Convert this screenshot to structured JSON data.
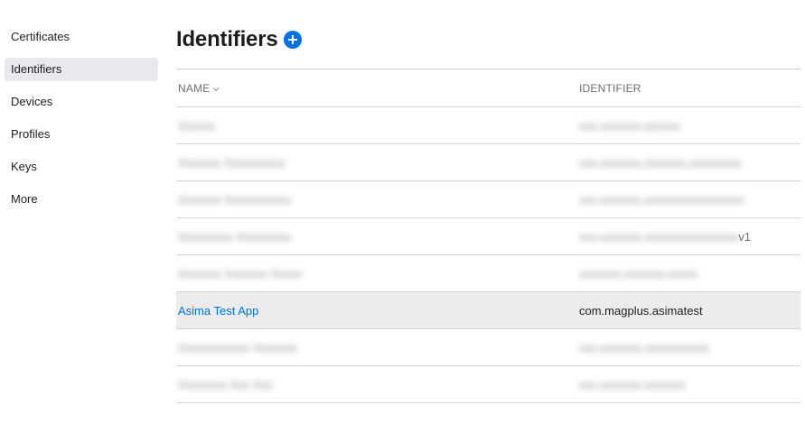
{
  "sidebar": {
    "items": [
      {
        "label": "Certificates"
      },
      {
        "label": "Identifiers"
      },
      {
        "label": "Devices"
      },
      {
        "label": "Profiles"
      },
      {
        "label": "Keys"
      },
      {
        "label": "More"
      }
    ],
    "active_index": 1
  },
  "header": {
    "title": "Identifiers",
    "add_icon": "plus-circle-icon",
    "accent_color": "#0071e3"
  },
  "table": {
    "columns": {
      "name": "NAME",
      "identifier": "IDENTIFIER"
    },
    "sort_icon": "chevron-down-icon",
    "rows": [
      {
        "name": "Xxxxxx",
        "identifier": "xxx.xxxxxxx.xxxxxx",
        "blurred": true
      },
      {
        "name": "Xxxxxxx Xxxxxxxxxx",
        "identifier": "xxx.xxxxxxx.xxxxxxx.xxxxxxxxx",
        "blurred": true
      },
      {
        "name": "Xxxxxxx Xxxxxxxxxxx",
        "identifier": "xxx.xxxxxxx.xxxxxxxxxxxxxxxxx",
        "blurred": true
      },
      {
        "name": "Xxxxxxxxx Xxxxxxxxx",
        "identifier": "xxx.xxxxxxx.xxxxxxxxxxxxxxxx",
        "suffix": "v1",
        "blurred": true
      },
      {
        "name": "Xxxxxxx Xxxxxxx Xxxxx",
        "identifier": "xxxxxxx.xxxxxxx.xxxxx",
        "blurred": true
      },
      {
        "name": "Asima Test App",
        "identifier": "com.magplus.asimatest",
        "blurred": false,
        "selected": true
      },
      {
        "name": "Xxxxxxxxxxxx Xxxxxxx",
        "identifier": "xxx.xxxxxxx.xxxxxxxxxxx",
        "blurred": true
      },
      {
        "name": "Xxxxxxxx Xxx Xxx",
        "identifier": "xxx.xxxxxxx.xxxxxxx",
        "blurred": true
      }
    ]
  }
}
